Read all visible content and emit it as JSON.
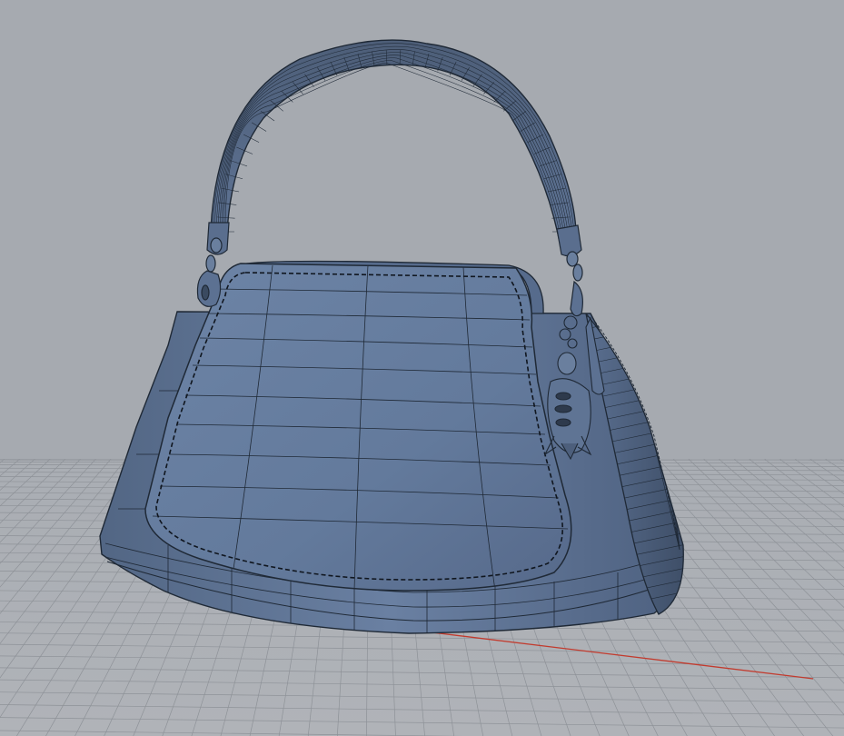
{
  "viewport": {
    "projection": "perspective",
    "display_mode": "shaded-with-isocurves",
    "background_color": "#a6aab0"
  },
  "construction_plane": {
    "grid": true,
    "grid_color": "#8e9298",
    "x_axis_color": "#c23b2e"
  },
  "model": {
    "object": "handbag",
    "surface_color": "#62789a",
    "edge_color": "#1f2936",
    "parts": [
      "body",
      "front-flap",
      "handle",
      "left-clasp",
      "right-clasp",
      "charm"
    ]
  }
}
